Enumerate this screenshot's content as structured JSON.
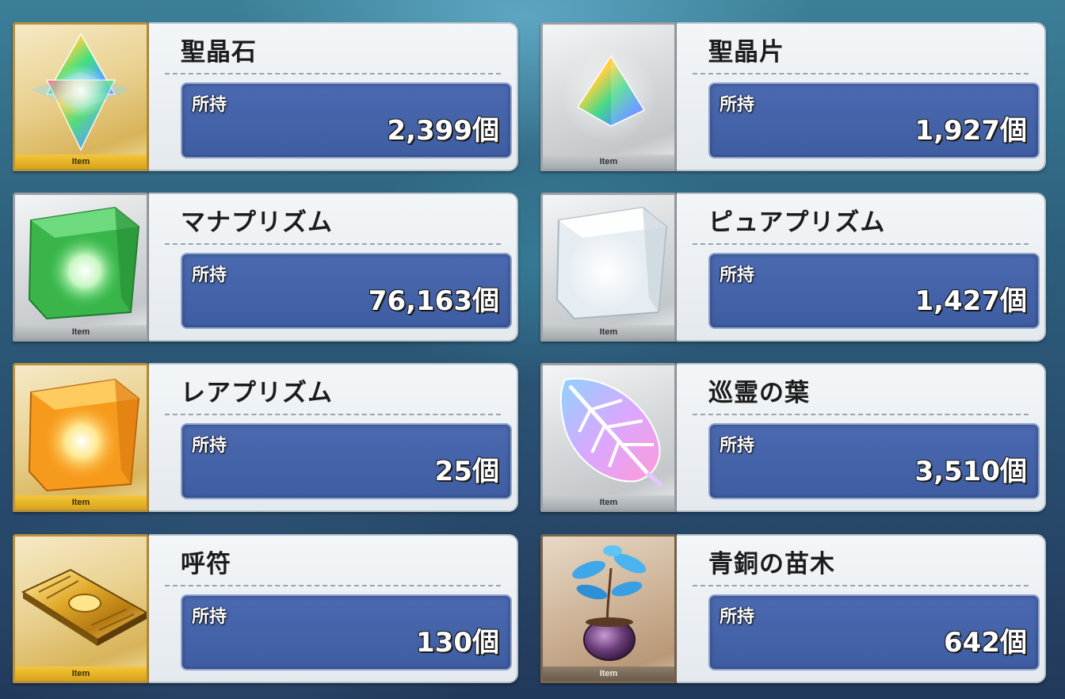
{
  "items": [
    {
      "name": "聖晶石",
      "owned_label": "所持",
      "count": "2,399個",
      "tag": "Item",
      "frame": "gold",
      "icon": "saint-quartz-icon"
    },
    {
      "name": "聖晶片",
      "owned_label": "所持",
      "count": "1,927個",
      "tag": "Item",
      "frame": "silver",
      "icon": "saint-quartz-fragment-icon"
    },
    {
      "name": "マナプリズム",
      "owned_label": "所持",
      "count": "76,163個",
      "tag": "Item",
      "frame": "silver",
      "icon": "mana-prism-icon"
    },
    {
      "name": "ピュアプリズム",
      "owned_label": "所持",
      "count": "1,427個",
      "tag": "Item",
      "frame": "silver",
      "icon": "pure-prism-icon"
    },
    {
      "name": "レアプリズム",
      "owned_label": "所持",
      "count": "25個",
      "tag": "Item",
      "frame": "gold",
      "icon": "rare-prism-icon"
    },
    {
      "name": "巡霊の葉",
      "owned_label": "所持",
      "count": "3,510個",
      "tag": "Item",
      "frame": "silver",
      "icon": "spirit-leaf-icon"
    },
    {
      "name": "呼符",
      "owned_label": "所持",
      "count": "130個",
      "tag": "Item",
      "frame": "gold",
      "icon": "summon-ticket-icon"
    },
    {
      "name": "青銅の苗木",
      "owned_label": "所持",
      "count": "642個",
      "tag": "Item",
      "frame": "bronze",
      "icon": "bronze-sapling-icon"
    }
  ],
  "colors": {
    "count_box": "#4a69b0",
    "gold_frame": "#b8913d",
    "silver_frame": "#9aa0a5",
    "bronze_frame": "#7a6550"
  }
}
